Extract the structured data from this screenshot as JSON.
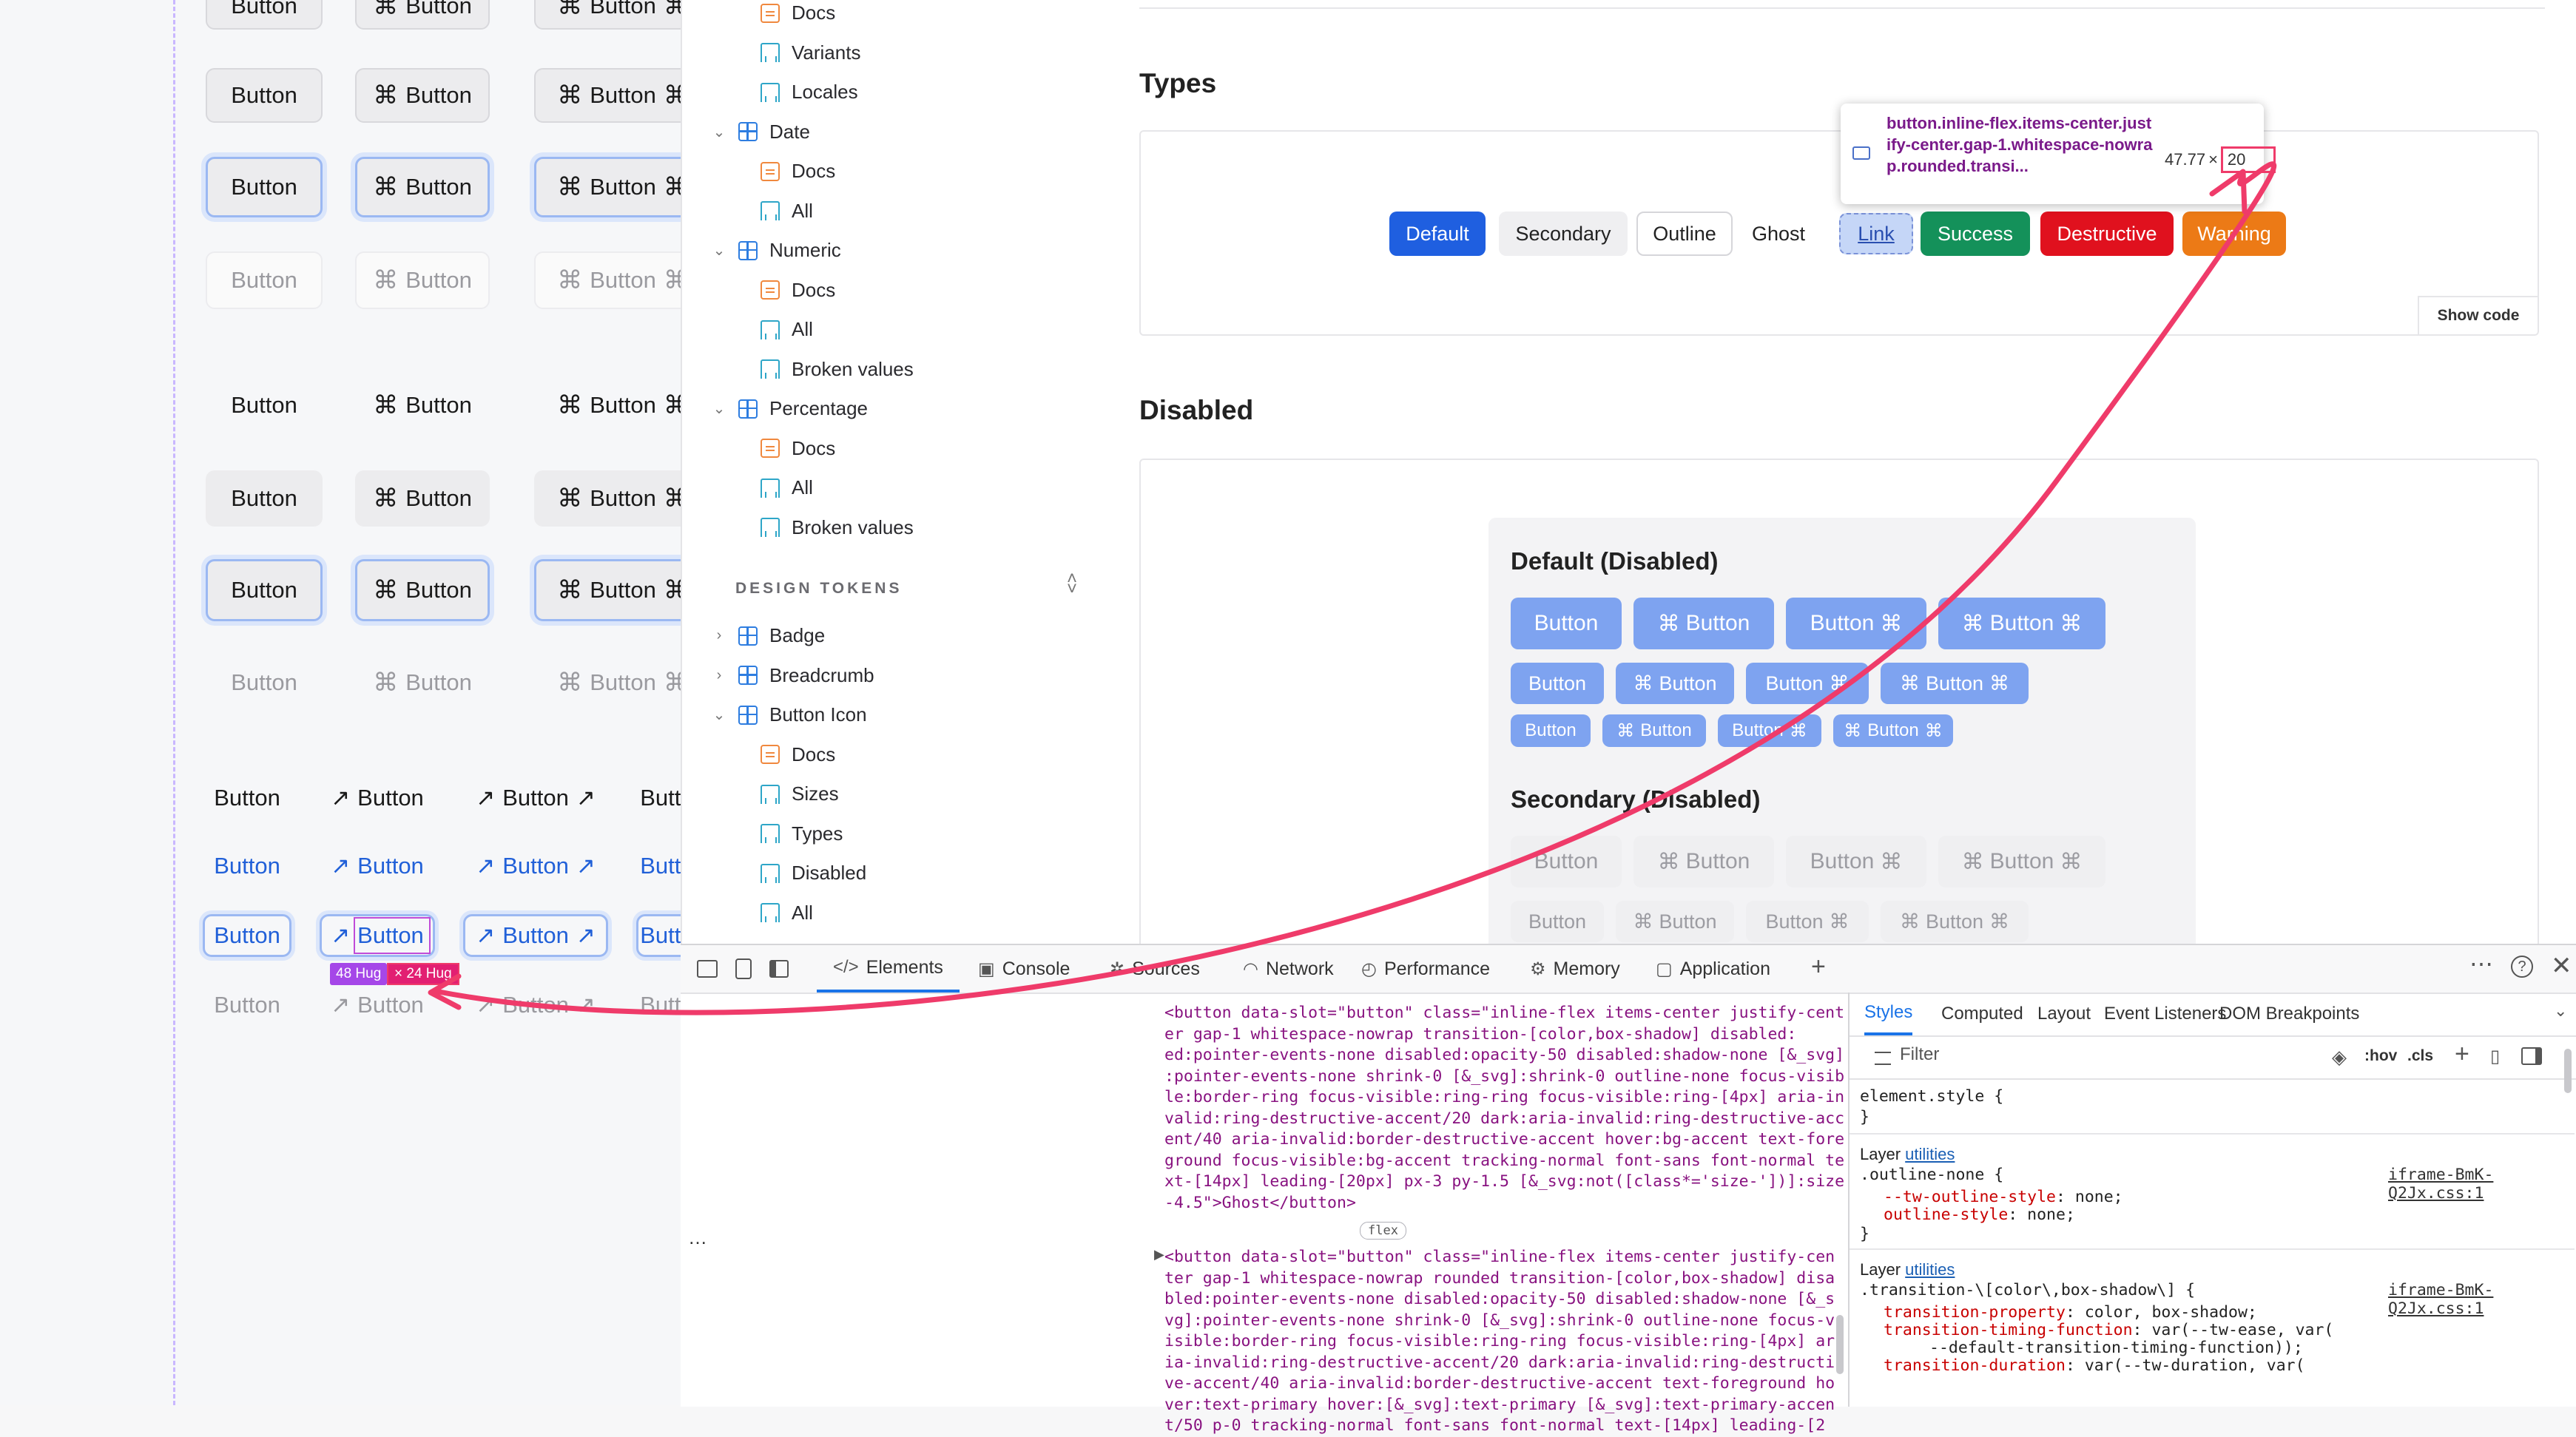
{
  "canvas": {
    "button_label": "Button",
    "cmd_glyph": "⌘",
    "arrow_glyph": "↗",
    "measure_badge_w": "48 Hug",
    "measure_badge_h": "× 24 Hug"
  },
  "sidebar": {
    "items": [
      {
        "label": "Docs",
        "kind": "doc"
      },
      {
        "label": "Variants",
        "kind": "story"
      },
      {
        "label": "Locales",
        "kind": "story"
      },
      {
        "label": "Date",
        "kind": "comp"
      },
      {
        "label": "Docs",
        "kind": "doc"
      },
      {
        "label": "All",
        "kind": "story"
      },
      {
        "label": "Numeric",
        "kind": "comp"
      },
      {
        "label": "Docs",
        "kind": "doc"
      },
      {
        "label": "All",
        "kind": "story"
      },
      {
        "label": "Broken values",
        "kind": "story"
      },
      {
        "label": "Percentage",
        "kind": "comp"
      },
      {
        "label": "Docs",
        "kind": "doc"
      },
      {
        "label": "All",
        "kind": "story"
      },
      {
        "label": "Broken values",
        "kind": "story"
      }
    ],
    "section_title": "DESIGN TOKENS",
    "token_items": [
      {
        "label": "Badge",
        "kind": "comp"
      },
      {
        "label": "Breadcrumb",
        "kind": "comp"
      },
      {
        "label": "Button Icon",
        "kind": "comp"
      },
      {
        "label": "Docs",
        "kind": "doc"
      },
      {
        "label": "Sizes",
        "kind": "story"
      },
      {
        "label": "Types",
        "kind": "story"
      },
      {
        "label": "Disabled",
        "kind": "story"
      },
      {
        "label": "All",
        "kind": "story"
      }
    ]
  },
  "main": {
    "types_heading": "Types",
    "type_buttons": {
      "default": "Default",
      "secondary": "Secondary",
      "outline": "Outline",
      "ghost": "Ghost",
      "link": "Link",
      "success": "Success",
      "destructive": "Destructive",
      "warning": "Warning"
    },
    "show_code": "Show code",
    "tooltip_selector": "button.inline-flex.items-center.justify-center.gap-1.whitespace-nowrap.rounded.transi...",
    "tooltip_size_w": "47.77",
    "tooltip_size_x": "×",
    "tooltip_size_h": "20",
    "disabled_heading": "Disabled",
    "default_disabled_heading": "Default (Disabled)",
    "secondary_disabled_heading": "Secondary (Disabled)",
    "button_label": "Button",
    "cmd_glyph": "⌘"
  },
  "devtools": {
    "tabs": [
      "Elements",
      "Console",
      "Sources",
      "Network",
      "Performance",
      "Memory",
      "Application"
    ],
    "code_lines_1": [
      "<button data-slot=\"button\" class=\"inline-flex items-center justify-cent",
      "er gap-1 whitespace-nowrap transition-[color,box-shadow] disabled:",
      "ed:pointer-events-none disabled:opacity-50 disabled:shadow-none [&_svg]",
      ":pointer-events-none shrink-0 [&_svg]:shrink-0 outline-none focus-visib",
      "le:border-ring focus-visible:ring-ring focus-visible:ring-[4px] aria-in",
      "valid:ring-destructive-accent/20 dark:aria-invalid:ring-destructive-acc",
      "ent/40 aria-invalid:border-destructive-accent hover:bg-accent text-fore",
      "ground focus-visible:bg-accent tracking-normal font-sans font-normal te",
      "xt-[14px] leading-[20px] px-3 py-1.5 [&_svg:not([class*='size-'])]:size",
      "-4.5\">Ghost</button>"
    ],
    "flex_badge": "flex",
    "code_lines_2": [
      "<button data-slot=\"button\" class=\"inline-flex items-center justify-cen",
      "ter gap-1 whitespace-nowrap rounded transition-[color,box-shadow] disa",
      "bled:pointer-events-none disabled:opacity-50 disabled:shadow-none [&_s",
      "vg]:pointer-events-none shrink-0 [&_svg]:shrink-0 outline-none focus-v",
      "isible:border-ring focus-visible:ring-ring focus-visible:ring-[4px] ar",
      "ia-invalid:ring-destructive-accent/20 dark:aria-invalid:ring-destructi",
      "ve-accent/40 aria-invalid:border-destructive-accent text-foreground ho",
      "ver:text-primary hover:[&_svg]:text-primary [&_svg]:text-primary-accen",
      "t/50 p-0 tracking-normal font-sans font-normal text-[14px] leading-[2"
    ],
    "ellipsis": "…",
    "styles_tabs": [
      "Styles",
      "Computed",
      "Layout",
      "Event Listeners",
      "DOM Breakpoints"
    ],
    "filter_placeholder": "Filter",
    "hov": ":hov",
    "cls": ".cls",
    "element_style": "element.style {",
    "close_brace": "}",
    "layer_label": "Layer",
    "layer_name": "utilities",
    "rule1_selector": ".outline-none {",
    "rule1_source": "iframe-BmK-Q2Jx.css:1",
    "rule1_props": [
      {
        "name": "--tw-outline-style",
        "value": "none;"
      },
      {
        "name": "outline-style",
        "value": "none;"
      }
    ],
    "rule2_selector": ".transition-\\[color\\,box-shadow\\] {",
    "rule2_source": "iframe-BmK-Q2Jx.css:1",
    "rule2_props": [
      {
        "name": "transition-property",
        "value": "color, box-shadow;"
      },
      {
        "name": "transition-timing-function",
        "value": "var(--tw-ease, var("
      },
      {
        "name": "",
        "value": "--default-transition-timing-function));"
      },
      {
        "name": "transition-duration",
        "value": "var(--tw-duration, var("
      }
    ]
  },
  "colors": {
    "primary": "#1f5fe0",
    "primary_disabled": "#7ea3f0",
    "success": "#14915a",
    "destructive": "#e0111e",
    "warning": "#ec7a16",
    "annotation": "#ef3b6a"
  }
}
